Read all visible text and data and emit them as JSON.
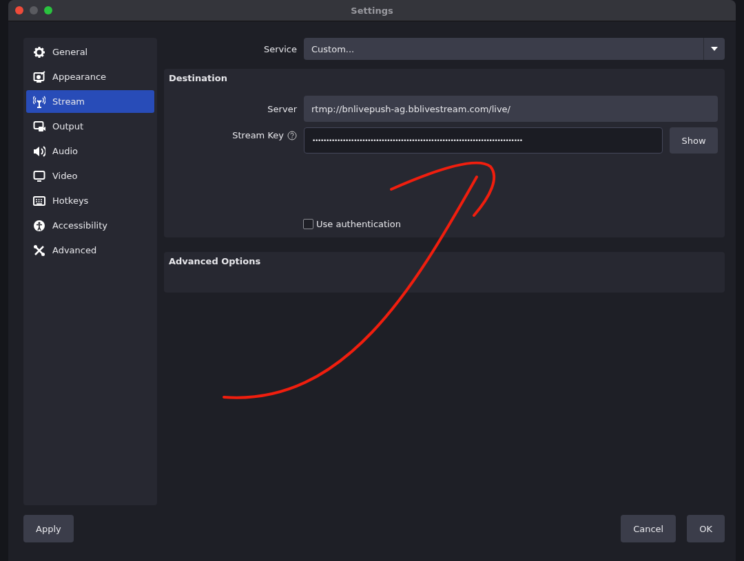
{
  "window": {
    "title": "Settings"
  },
  "sidebar": {
    "items": [
      {
        "label": "General",
        "selected": false
      },
      {
        "label": "Appearance",
        "selected": false
      },
      {
        "label": "Stream",
        "selected": true
      },
      {
        "label": "Output",
        "selected": false
      },
      {
        "label": "Audio",
        "selected": false
      },
      {
        "label": "Video",
        "selected": false
      },
      {
        "label": "Hotkeys",
        "selected": false
      },
      {
        "label": "Accessibility",
        "selected": false
      },
      {
        "label": "Advanced",
        "selected": false
      }
    ]
  },
  "service": {
    "label": "Service",
    "value": "Custom..."
  },
  "destination": {
    "title": "Destination",
    "server": {
      "label": "Server",
      "value": "rtmp://bnlivepush-ag.bblivestream.com/live/"
    },
    "stream_key": {
      "label": "Stream Key",
      "value": "••••••••••••••••••••••••••••••••••••••••••••••••••••••••••••••••••••••••••••",
      "button": "Show"
    },
    "use_authentication": {
      "label": "Use authentication",
      "checked": false
    }
  },
  "advanced_options": {
    "title": "Advanced Options"
  },
  "annotation": {
    "kind": "arrow"
  },
  "buttons": {
    "apply": "Apply",
    "cancel": "Cancel",
    "ok": "OK"
  }
}
